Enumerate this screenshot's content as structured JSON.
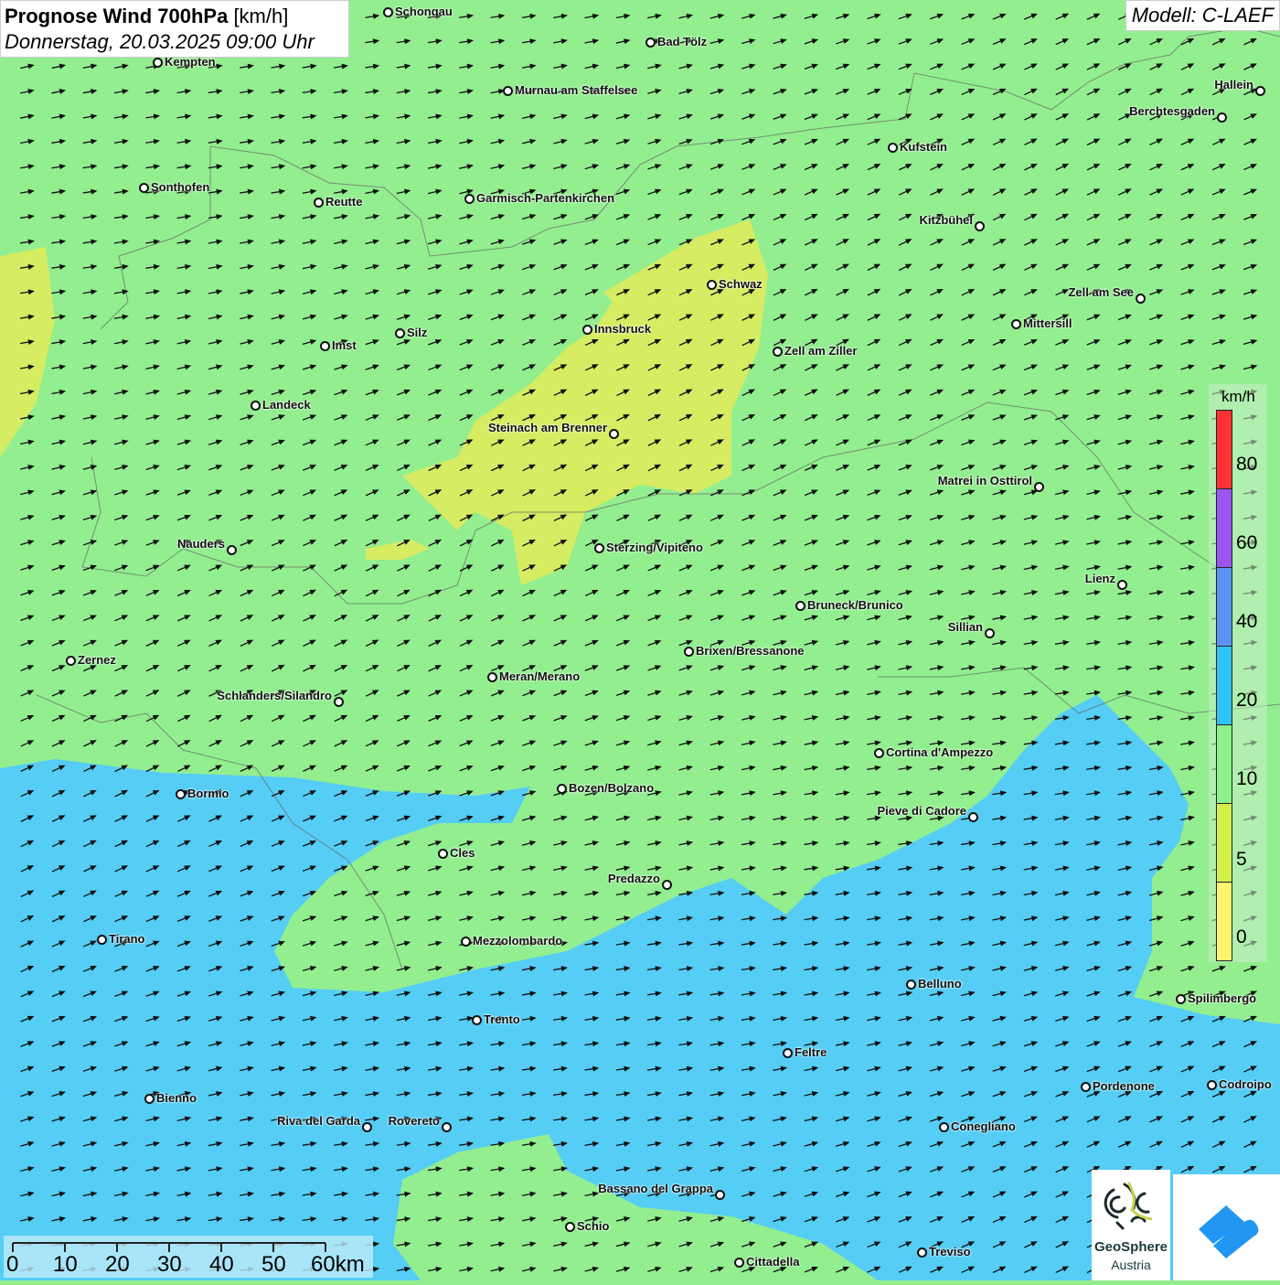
{
  "title": {
    "main": "Prognose Wind 700hPa",
    "unit": "[km/h]",
    "datetime": "Donnerstag, 20.03.2025 09:00 Uhr"
  },
  "model": "Modell: C-LAEF",
  "legend": {
    "unit": "km/h",
    "labels": [
      "80",
      "60",
      "40",
      "20",
      "10",
      "5",
      "0"
    ],
    "colors": [
      "#ff3333",
      "#9a55f2",
      "#5b93f2",
      "#2ec4f5",
      "#8ef08a",
      "#d4ee4a",
      "#fcf570"
    ]
  },
  "colors": {
    "green": "#93ee90",
    "blue": "#55cdf5",
    "yellow": "#d6ec63",
    "arrow": "#111111"
  },
  "scale": {
    "labels": [
      "0",
      "10",
      "20",
      "30",
      "40",
      "50",
      "60km"
    ]
  },
  "logos": {
    "geosphere_line1": "GeoSphere",
    "geosphere_line2": "Austria"
  },
  "cities": [
    "Schongau",
    "Bad Tölz",
    "Kempten",
    "Murnau am Staffelsee",
    "Hallein",
    "Berchtesgaden",
    "Kufstein",
    "Sonthofen",
    "Reutte",
    "Garmisch-Partenkirchen",
    "Kitzbühel",
    "Schwaz",
    "Zell am See",
    "Mittersill",
    "Innsbruck",
    "Silz",
    "Imst",
    "Zell am Ziller",
    "Landeck",
    "Steinach am Brenner",
    "Matrei in Osttirol",
    "Nauders",
    "Sterzing/Vipiteno",
    "Lienz",
    "Bruneck/Brunico",
    "Sillian",
    "Brixen/Bressanone",
    "Zernez",
    "Meran/Merano",
    "Schlanders/Silandro",
    "Cortina d'Ampezzo",
    "Bozen/Bolzano",
    "Bormio",
    "Pieve di Cadore",
    "Cles",
    "Predazzo",
    "Tirano",
    "Mezzolombardo",
    "Belluno",
    "Spilimbergo",
    "Trento",
    "Feltre",
    "Pordenone",
    "Codroipo",
    "Bienno",
    "Riva del Garda",
    "Rovereto",
    "Conegliano",
    "Bassano del Grappa",
    "Schio",
    "Treviso",
    "Cittadella"
  ]
}
